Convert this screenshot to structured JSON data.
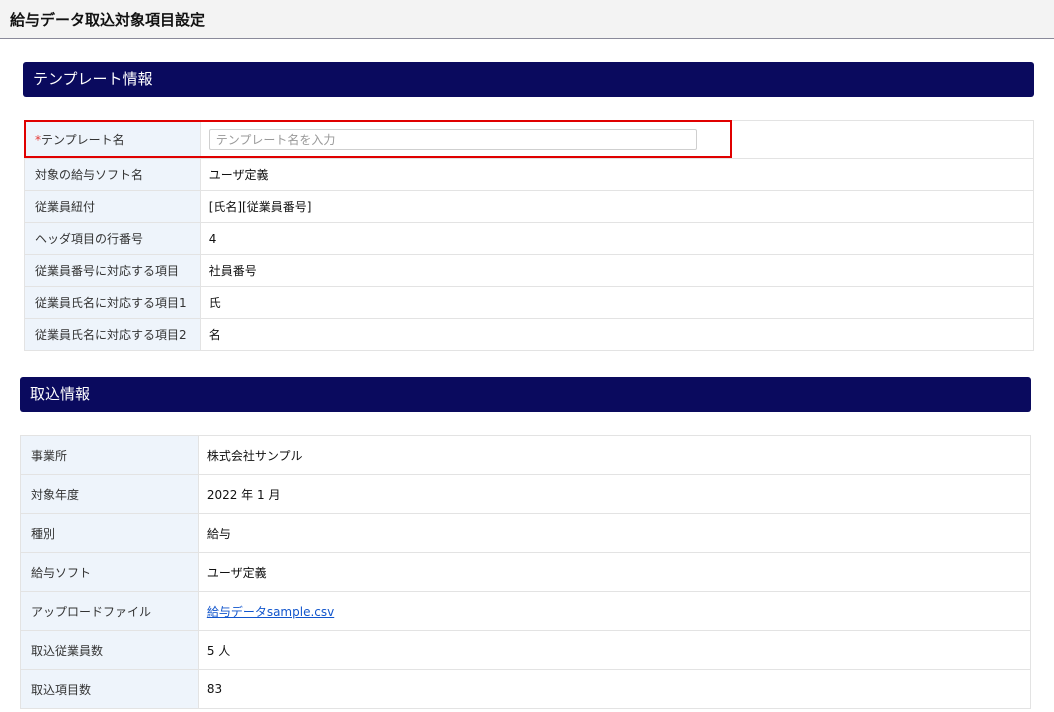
{
  "page": {
    "title": "給与データ取込対象項目設定"
  },
  "template_section": {
    "heading": "テンプレート情報",
    "template_name": {
      "required_mark": "*",
      "label": "テンプレート名",
      "value": "",
      "placeholder": "テンプレート名を入力"
    },
    "rows": [
      {
        "label": "対象の給与ソフト名",
        "value": "ユーザ定義"
      },
      {
        "label": "従業員紐付",
        "value": "[氏名][従業員番号]"
      },
      {
        "label": "ヘッダ項目の行番号",
        "value": "4"
      },
      {
        "label": "従業員番号に対応する項目",
        "value": "社員番号"
      },
      {
        "label": "従業員氏名に対応する項目1",
        "value": "氏"
      },
      {
        "label": "従業員氏名に対応する項目2",
        "value": "名"
      }
    ]
  },
  "import_section": {
    "heading": "取込情報",
    "rows": [
      {
        "label": "事業所",
        "value": "株式会社サンプル"
      },
      {
        "label": "対象年度",
        "value": "2022 年 1 月"
      },
      {
        "label": "種別",
        "value": "給与"
      },
      {
        "label": "給与ソフト",
        "value": "ユーザ定義"
      },
      {
        "label": "アップロードファイル",
        "value": "給与データsample.csv"
      },
      {
        "label": "取込従業員数",
        "value": "5 人"
      },
      {
        "label": "取込項目数",
        "value": "83"
      }
    ]
  }
}
